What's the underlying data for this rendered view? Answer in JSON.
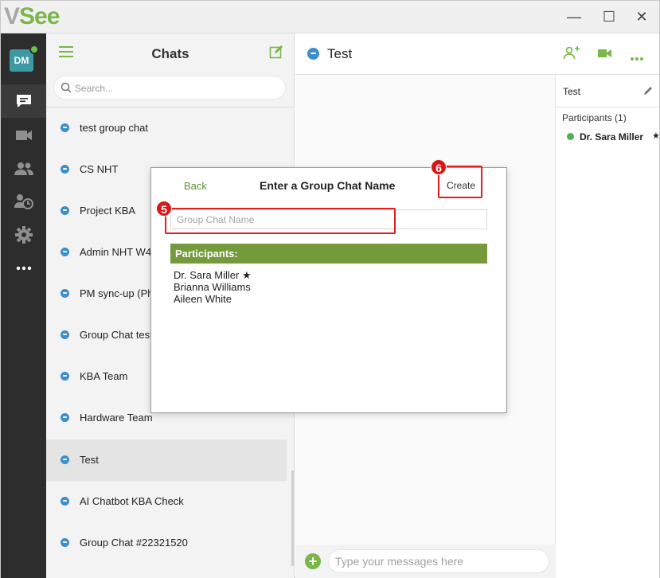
{
  "app": {
    "logo_v": "V",
    "logo_see": "See",
    "window_controls": {
      "minimize": "—",
      "maximize": "☐",
      "close": "✕"
    }
  },
  "rail": {
    "avatar_initials": "DM",
    "items": [
      "chat-icon",
      "video-icon",
      "contacts-icon",
      "history-icon",
      "settings-icon",
      "more-icon"
    ]
  },
  "chat_list": {
    "title": "Chats",
    "search_placeholder": "Search...",
    "items": [
      {
        "label": "test group chat"
      },
      {
        "label": "CS NHT"
      },
      {
        "label": "Project KBA"
      },
      {
        "label": "Admin NHT W4"
      },
      {
        "label": "PM sync-up (Ph"
      },
      {
        "label": "Group Chat test"
      },
      {
        "label": "KBA Team"
      },
      {
        "label": "Hardware Team"
      },
      {
        "label": "Test"
      },
      {
        "label": "AI Chatbot KBA Check"
      },
      {
        "label": "Group Chat #22321520"
      }
    ],
    "selected_index": 8
  },
  "conversation": {
    "title": "Test",
    "message_placeholder": "Type your messages here",
    "add_label": "+"
  },
  "side_panel": {
    "title": "Test",
    "participants_label": "Participants (1)",
    "participant_name": "Dr. Sara Miller",
    "star": "★"
  },
  "dialog": {
    "back_label": "Back",
    "title": "Enter a Group Chat Name",
    "create_label": "Create",
    "name_placeholder": "Group Chat Name",
    "participants_header": "Participants:",
    "participants": [
      "Dr. Sara Miller ★",
      "Brianna Williams",
      "Aileen White"
    ]
  },
  "callouts": {
    "name_field_number": "5",
    "create_number": "6",
    "color": "#e21d1d"
  },
  "colors": {
    "brand_green": "#7ab648",
    "rail_bg": "#2d2d2d",
    "participants_header_bg": "#759a3c"
  }
}
